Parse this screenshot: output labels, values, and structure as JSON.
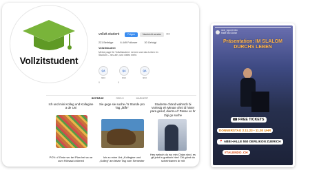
{
  "profile": {
    "logo_text": "Vollzitstudent",
    "username": "vollzit.student",
    "follow_label": "Folgen",
    "message_label": "Nachricht senden",
    "more_label": "•••",
    "stats": [
      "221 Beiträge",
      "6.449 Follower",
      "30 Gefolgt"
    ],
    "display_name": "Vollzitstudent",
    "bio": "Meine page für Vollzitstudent. Lernen und das Leben im Studium – neu-ein, und vieles mehr.",
    "highlights": [
      {
        "icon": "QA",
        "label": "Q&A"
      },
      {
        "icon": "QA",
        "label": "Q&A"
      },
      {
        "icon": "QA",
        "label": "Q&A"
      }
    ],
    "toggle_values": [
      "0",
      "0"
    ],
    "tabs": [
      "BEITRÄGE",
      "REELS",
      "MARKIERT"
    ],
    "tiles": [
      {
        "top": "Ich und mini Kolleg und Kollegine a de Uni",
        "bottom": "POV: d' Ersie wo kei Plan hei wo ar zum Hörsaal chömed"
      },
      {
        "top": "Sie gege sie suche / 5 Stunde pro Tag „läffe“",
        "bottom": "Ich zu mine Uni-„Kollegine und „Kolleg“ am letzte Tag vom Semester"
      },
      {
        "top": "Studente chönd wahrsch bi Vorlesig eh Minute ohni id hinter para gesuf, diermu d' Passe vo hr Zigi go suche",
        "bottom": "Hey weisch du wo min Chips sind, es git jetzt is gratisch hier! Chi gönd da scheinbarem dr mit"
      }
    ]
  },
  "story": {
    "user_line1": "next_topnet 16m",
    "user_line2": "Halle 550 Zürich",
    "headline": "Präsentation: IM SLALOM DURCHS LEBEN",
    "free_tickets": "🎟 FREE TICKETS",
    "date": "DONNERSTAG 2.11.23 • 11.30 UHR",
    "venue": "📍 ABB HALLE 550 OERLIKON ZUERICH",
    "hashtag": "#TALENDO_CH"
  }
}
